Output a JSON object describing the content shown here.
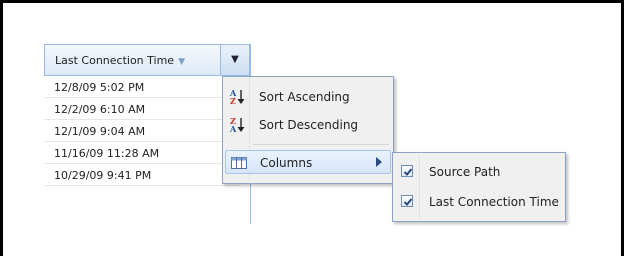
{
  "grid": {
    "column_header": "Last Connection Time",
    "sort_arrow_icon": "sort-down-icon",
    "trigger_icon": "dropdown-arrow-icon",
    "rows": [
      "12/8/09 5:02 PM",
      "12/2/09 6:10 AM",
      "12/1/09 9:04 AM",
      "11/16/09 11:28 AM",
      "10/29/09 9:41 PM"
    ]
  },
  "menu": {
    "sort_ascending": "Sort Ascending",
    "sort_descending": "Sort Descending",
    "columns": "Columns",
    "icons": [
      "sort-az-icon",
      "sort-za-icon",
      "columns-icon",
      "chevron-right-icon"
    ]
  },
  "submenu": {
    "items": [
      {
        "label": "Source Path",
        "checked": true
      },
      {
        "label": "Last Connection Time",
        "checked": true
      }
    ]
  },
  "colors": {
    "border": "#99bbe8",
    "menu_bg": "#f0f0f0",
    "active_bg": "#d6e6fa"
  }
}
